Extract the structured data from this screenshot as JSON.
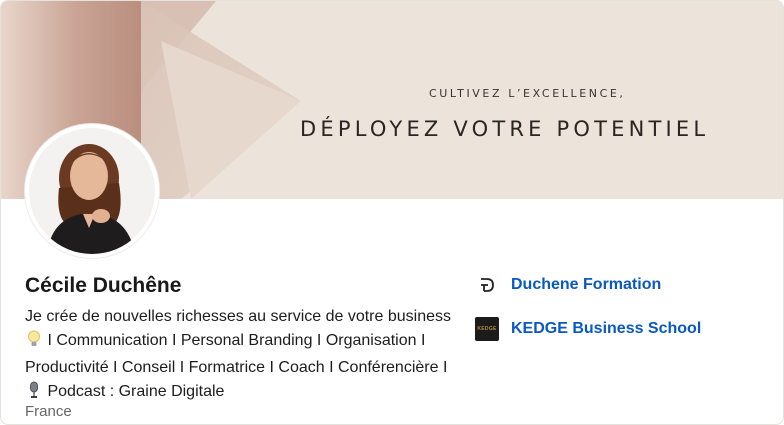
{
  "banner": {
    "tagline": "CULTIVEZ L’EXCELLENCE,",
    "headline": "DÉPLOYEZ VOTRE POTENTIEL"
  },
  "profile": {
    "name": "Cécile Duchêne",
    "headline_parts": [
      "Je crée de nouvelles richesses au service de votre business",
      "I Communication I Personal Branding I Organisation I Productivité I Conseil I Formatrice I Coach I Conférencière I",
      "Podcast : Graine Digitale"
    ],
    "location": "France"
  },
  "organizations": [
    {
      "name": "Duchene Formation",
      "logo": "duchene-formation-logo"
    },
    {
      "name": "KEDGE Business School",
      "logo": "kedge-logo",
      "logo_text": "KEDGE"
    }
  ],
  "colors": {
    "banner_bg": "#ece3db",
    "link_blue": "#0a58c2",
    "muted_text": "#666666"
  }
}
